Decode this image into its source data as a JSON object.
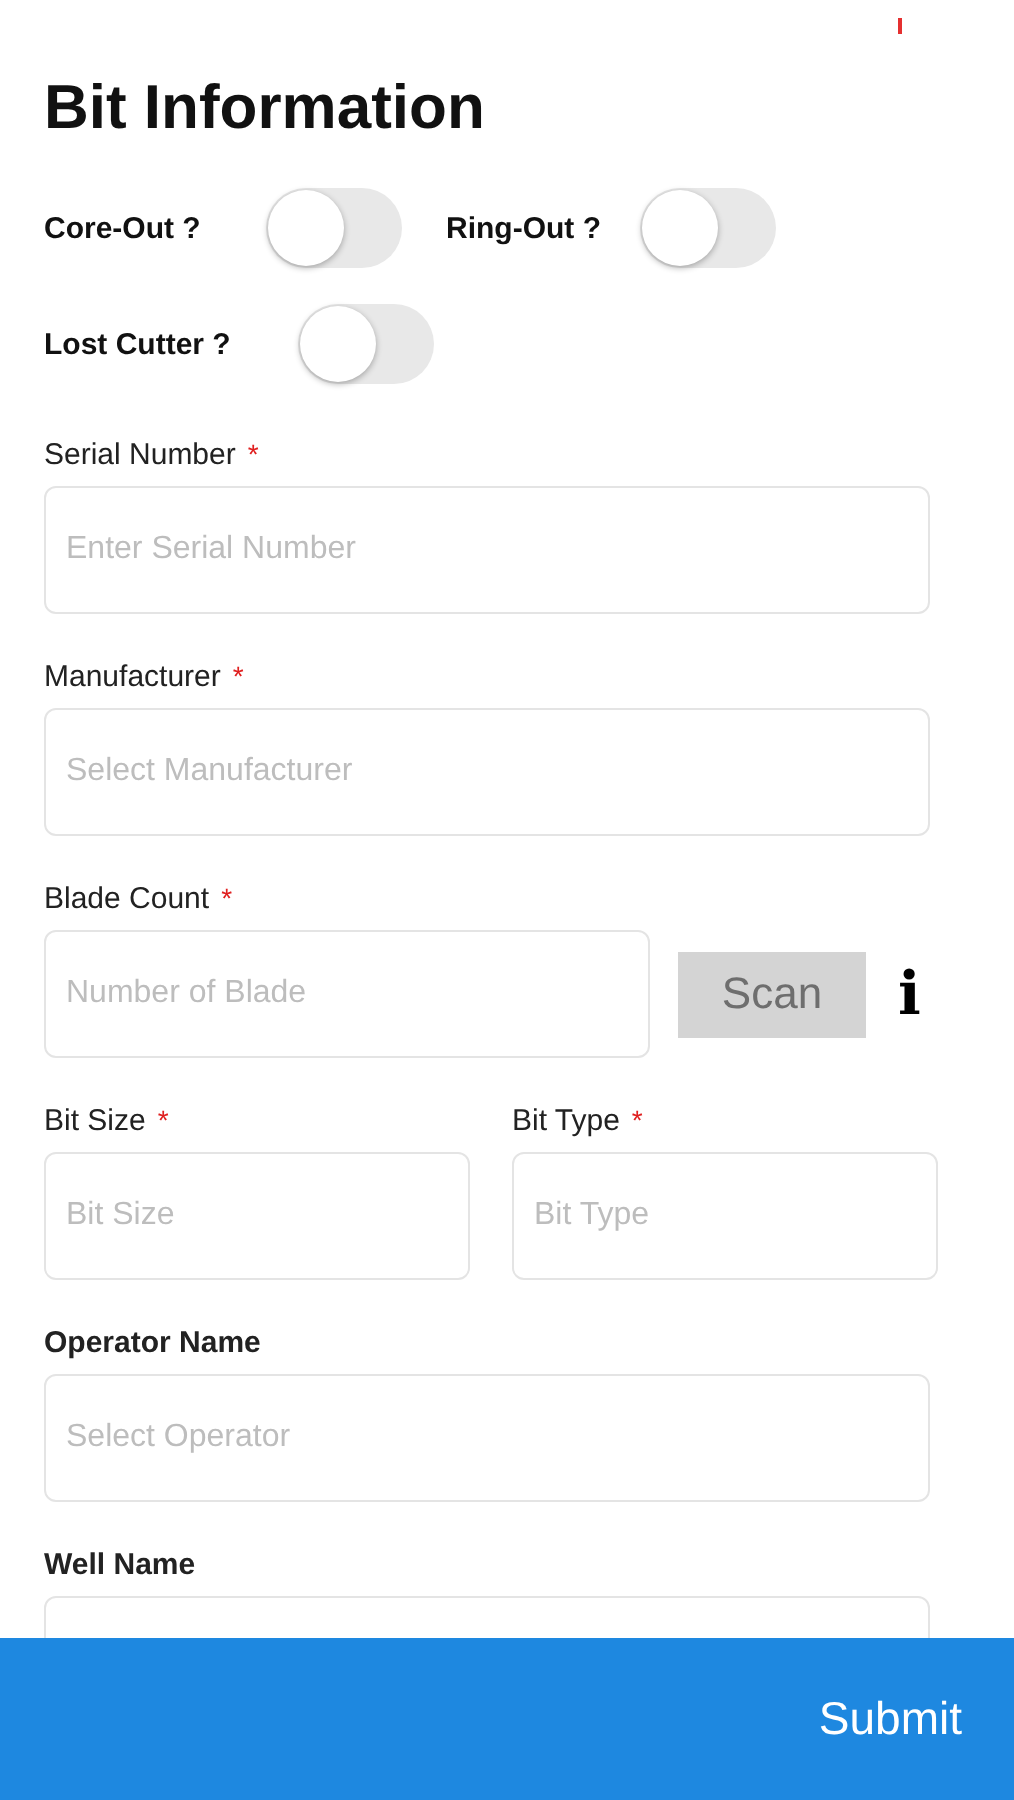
{
  "title": "Bit Information",
  "toggle_rows": [
    [
      {
        "label": "Core-Out ?",
        "on": false
      },
      {
        "label": "Ring-Out ?",
        "on": false
      }
    ],
    [
      {
        "label": "Lost Cutter ?",
        "on": false
      }
    ]
  ],
  "required_mark": "*",
  "rows": [
    {
      "kind": "single",
      "fields": [
        {
          "label": "Serial Number",
          "required": true,
          "placeholder": "Enter Serial Number"
        }
      ]
    },
    {
      "kind": "single",
      "fields": [
        {
          "label": "Manufacturer",
          "required": true,
          "placeholder": "Select Manufacturer"
        }
      ]
    },
    {
      "kind": "scan",
      "fields": [
        {
          "label": "Blade Count",
          "required": true,
          "placeholder": "Number of Blade"
        }
      ],
      "button": "Scan",
      "info": "i"
    },
    {
      "kind": "pair",
      "fields": [
        {
          "label": "Bit Size",
          "required": true,
          "placeholder": "Bit Size"
        },
        {
          "label": "Bit Type",
          "required": true,
          "placeholder": "Bit Type"
        }
      ]
    },
    {
      "kind": "single",
      "fields": [
        {
          "label": "Operator Name",
          "required": false,
          "placeholder": "Select Operator"
        }
      ]
    },
    {
      "kind": "single",
      "fields": [
        {
          "label": "Well Name",
          "required": false
        }
      ]
    }
  ],
  "submit": "Submit"
}
